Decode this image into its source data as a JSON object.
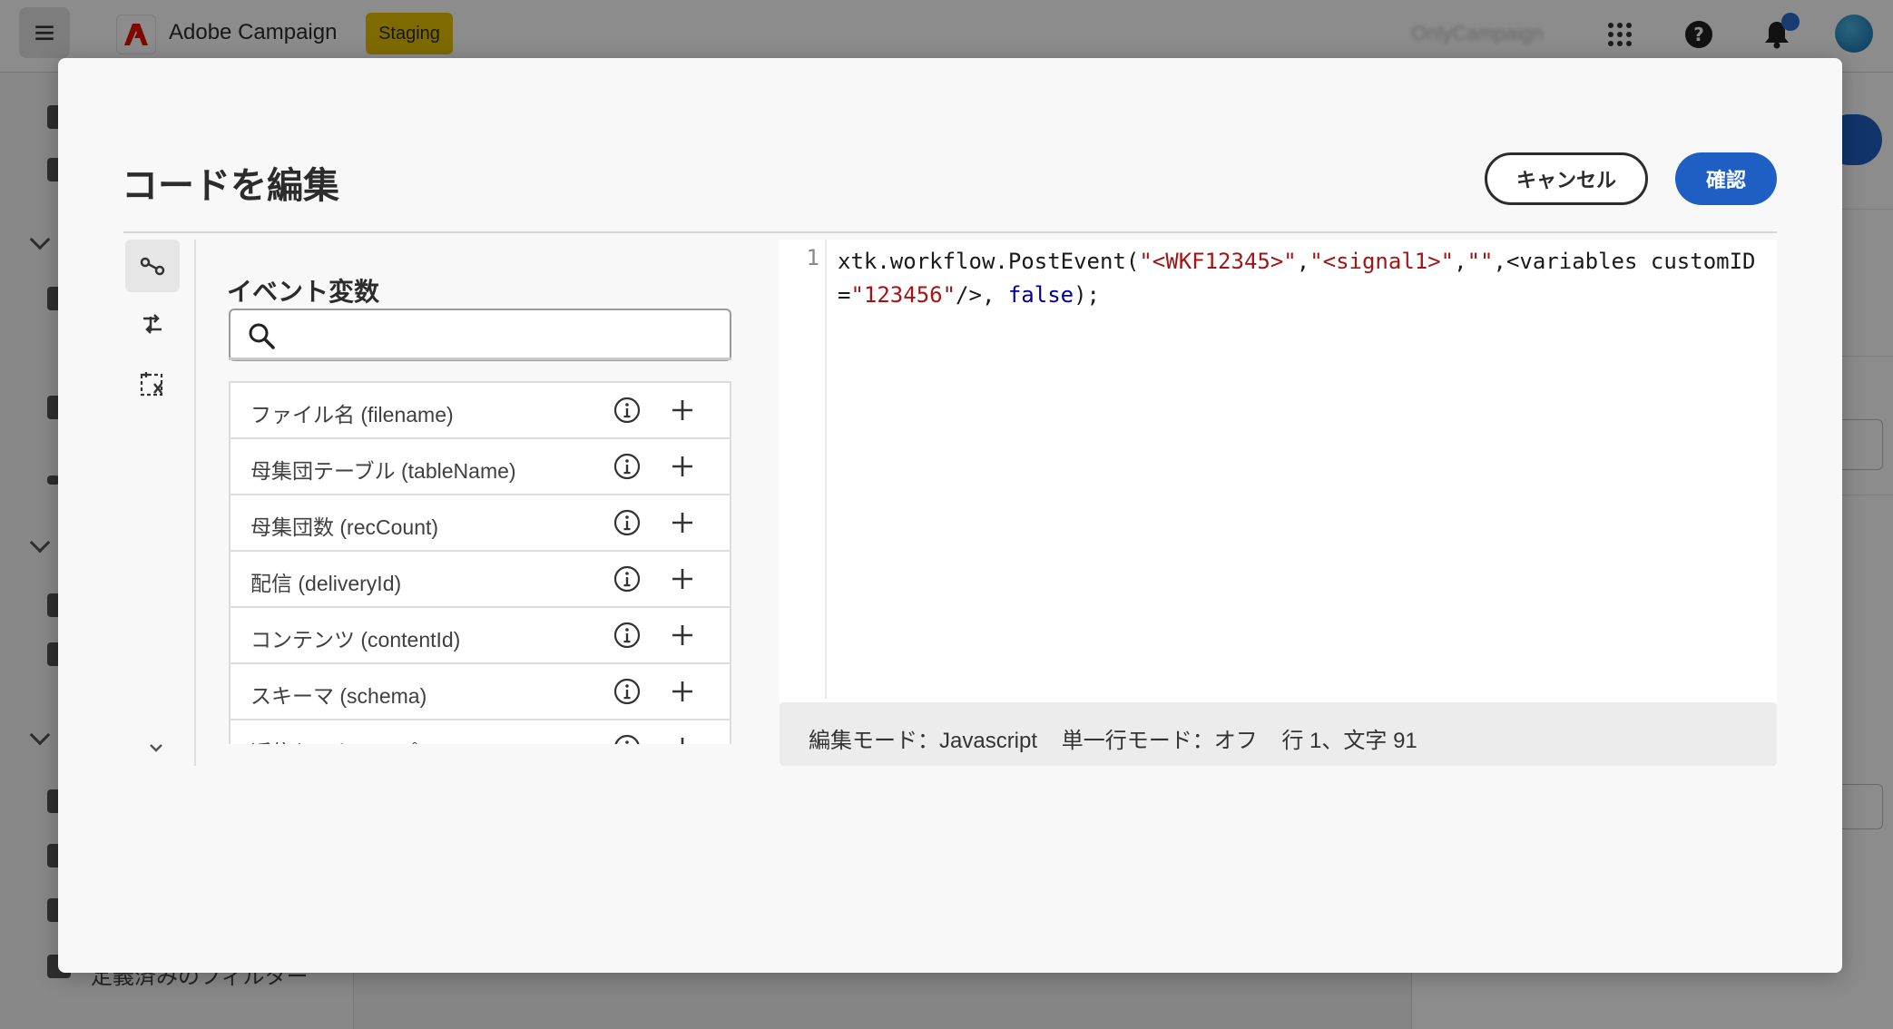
{
  "app": {
    "name": "Adobe Campaign",
    "environment": "Staging",
    "org": "OnlyCampaign"
  },
  "background": {
    "sidebar_text": "定義済みのフィルター"
  },
  "modal": {
    "title": "コードを編集",
    "cancel_label": "キャンセル",
    "confirm_label": "確認"
  },
  "variables": {
    "heading": "イベント変数",
    "search_placeholder": "",
    "items": [
      {
        "label": "ファイル名 (filename)"
      },
      {
        "label": "母集団テーブル (tableName)"
      },
      {
        "label": "母集団数 (recCount)"
      },
      {
        "label": "配信 (deliveryId)"
      },
      {
        "label": "コンテンツ (contentId)"
      },
      {
        "label": "スキーマ (schema)"
      },
      {
        "label": "返信セットアップ (…)"
      }
    ]
  },
  "editor": {
    "line_number": "1",
    "code_tokens": [
      {
        "t": "xtk.workflow.PostEvent(",
        "c": ""
      },
      {
        "t": "\"<WKF12345>\"",
        "c": "str"
      },
      {
        "t": ",",
        "c": ""
      },
      {
        "t": "\"<signal1>\"",
        "c": "str"
      },
      {
        "t": ",",
        "c": ""
      },
      {
        "t": "\"\"",
        "c": "str"
      },
      {
        "t": ",<variables customID=",
        "c": ""
      },
      {
        "t": "\"123456\"",
        "c": "str"
      },
      {
        "t": "/>, ",
        "c": ""
      },
      {
        "t": "false",
        "c": "kw"
      },
      {
        "t": ");",
        "c": ""
      }
    ]
  },
  "status": {
    "mode": "編集モード：Javascript",
    "single_line": "単一行モード：オフ",
    "position": "行 1、文字 91"
  },
  "colors": {
    "primary": "#1f5fc4",
    "staging_badge": "#e8c200",
    "adobe_red": "#eb1000",
    "string": "#a31515",
    "keyword": "#0000a0"
  }
}
